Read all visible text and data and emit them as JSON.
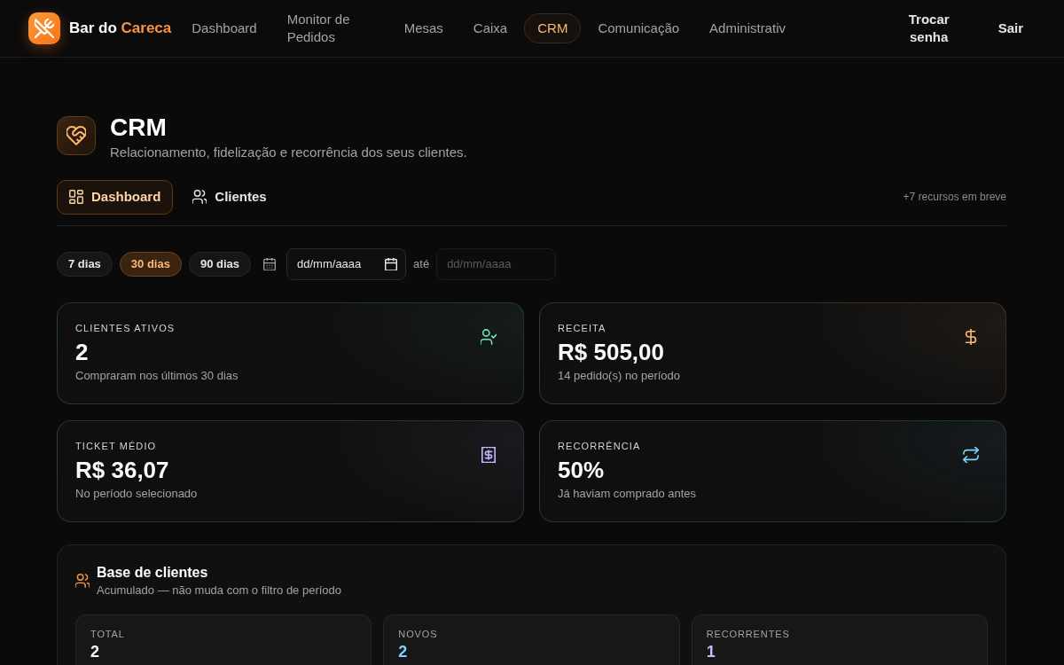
{
  "navbar": {
    "brand": {
      "name": "Bar do",
      "accent": "Careca"
    },
    "items": [
      {
        "label": "Dashboard",
        "selected": false
      },
      {
        "label": "Monitor de Pedidos",
        "selected": false
      },
      {
        "label": "Mesas",
        "selected": false
      },
      {
        "label": "Caixa",
        "selected": false
      },
      {
        "label": "CRM",
        "selected": true
      },
      {
        "label": "Comunicação",
        "selected": false
      },
      {
        "label": "Administrativ",
        "selected": false
      }
    ],
    "actions": [
      {
        "label": "Trocar senha"
      },
      {
        "label": "Sair"
      }
    ]
  },
  "header": {
    "title": "CRM",
    "subtitle": "Relacionamento, fidelização e recorrência dos seus clientes."
  },
  "tabs": [
    {
      "label": "Dashboard",
      "kind": "grid",
      "selected": true
    },
    {
      "label": "Clientes",
      "kind": "users",
      "selected": false
    }
  ],
  "tabs_note": "+7 recursos em breve",
  "filters": {
    "periods": [
      {
        "label": "7 dias",
        "selected": false
      },
      {
        "label": "30 dias",
        "selected": true
      },
      {
        "label": "90 dias",
        "selected": false
      }
    ],
    "date_from": {
      "placeholder": "dd/mm/aaaa",
      "disabled": false
    },
    "separator": "até",
    "date_to": {
      "placeholder": "dd/mm/aaaa",
      "disabled": true
    }
  },
  "stats": [
    {
      "kind": "user-check",
      "label": "CLIENTES ATIVOS",
      "value": "2",
      "note": "Compraram nos últimos 30 dias",
      "color": "#6ee7b7"
    },
    {
      "kind": "dollar",
      "label": "RECEITA",
      "value": "R$ 505,00",
      "note": "14 pedido(s) no período",
      "color": "#fdba74"
    },
    {
      "kind": "receipt",
      "label": "TICKET MÉDIO",
      "value": "R$ 36,07",
      "note": "No período selecionado",
      "color": "#c4b5fd"
    },
    {
      "kind": "repeat",
      "label": "RECORRÊNCIA",
      "value": "50%",
      "note": "Já haviam comprado antes",
      "color": "#7dd3fc"
    }
  ],
  "customer_base": {
    "title": "Base de clientes",
    "subtitle": "Acumulado — não muda com o filtro de período",
    "metrics": [
      {
        "label": "TOTAL",
        "value": "2",
        "color": "#fafafa"
      },
      {
        "label": "NOVOS",
        "value": "2",
        "color": "#7dd3fc"
      },
      {
        "label": "RECORRENTES",
        "value": "1",
        "color": "#c4b5fd"
      }
    ]
  }
}
